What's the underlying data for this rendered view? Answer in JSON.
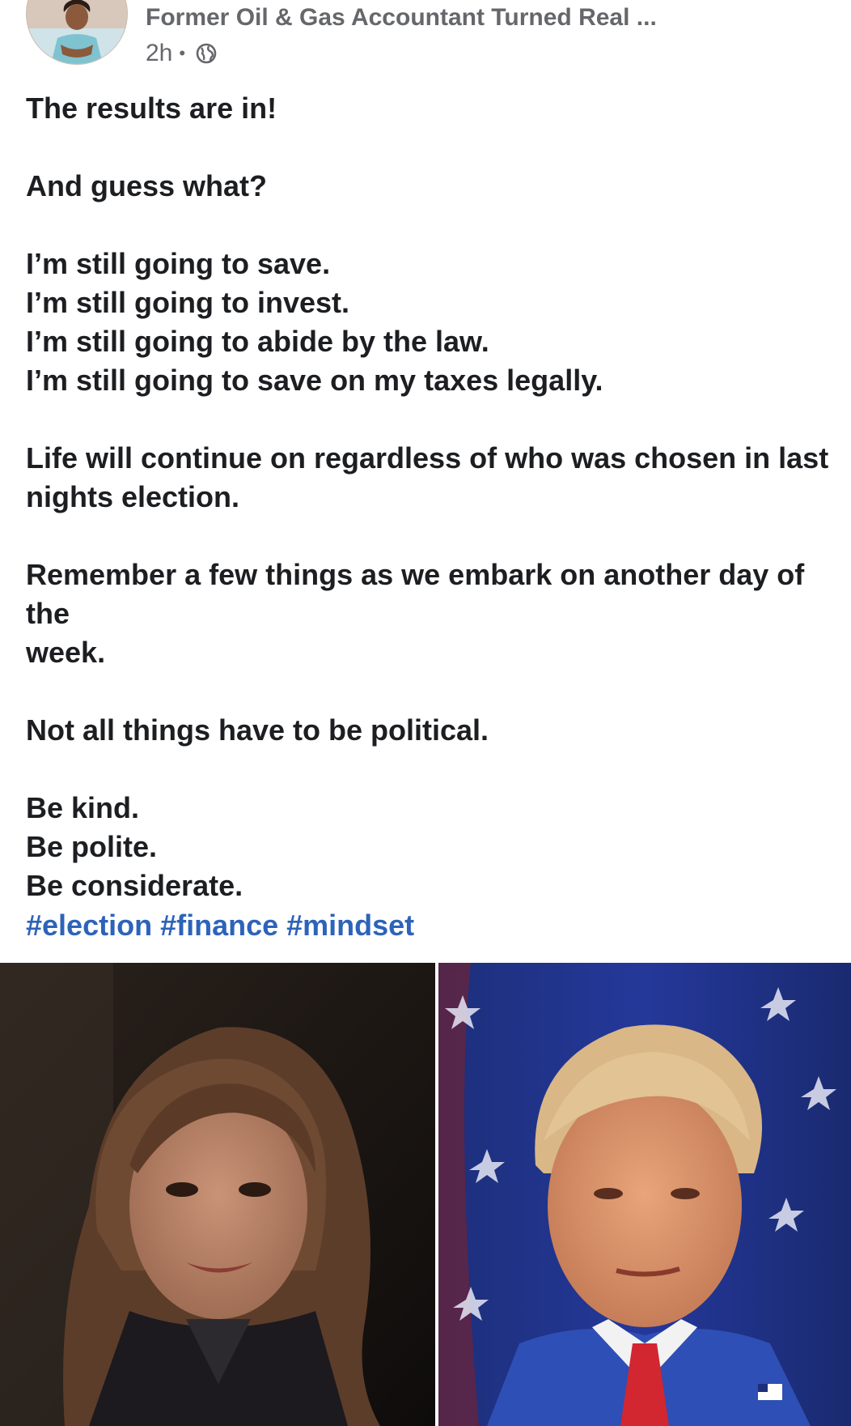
{
  "post": {
    "author": "Former Oil & Gas Accountant Turned Real ...",
    "time": "2h",
    "separator": "•",
    "privacy_icon": "globe-icon",
    "paragraphs": [
      [
        "The results are in!"
      ],
      [
        "And guess what?"
      ],
      [
        "I’m still going to save.",
        "I’m still going to invest.",
        "I’m still going to abide by the law.",
        "I’m still going to save on my taxes legally."
      ],
      [
        "Life will continue on regardless of who was chosen in last",
        "nights election."
      ],
      [
        "Remember a few things as we embark on another day of the",
        "week."
      ],
      [
        "Not all things have to be political."
      ],
      [
        "Be kind.",
        "Be polite.",
        "Be considerate."
      ]
    ],
    "hashtags": [
      "#election",
      "#finance",
      "#mindset"
    ]
  },
  "colors": {
    "hashtag": "#2d63b9",
    "meta_text": "#65676b",
    "body_text": "#1c1e21"
  }
}
